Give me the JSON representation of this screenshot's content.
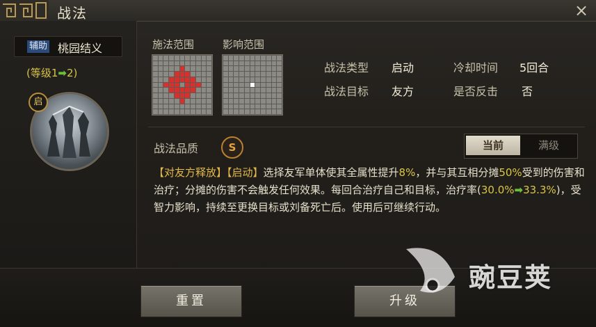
{
  "window": {
    "title": "战法",
    "close_icon": "×"
  },
  "skill": {
    "type_tag": "辅助",
    "name": "桃园结义",
    "level_prefix": "(等级1",
    "level_arrow": "➡",
    "level_suffix": "2)",
    "portrait_badge": "启"
  },
  "ranges": {
    "cast_label": "施法范围",
    "effect_label": "影响范围"
  },
  "info": {
    "type_label": "战法类型",
    "type_value": "启动",
    "cooldown_label": "冷却时间",
    "cooldown_value": "5回合",
    "target_label": "战法目标",
    "target_value": "友方",
    "counter_label": "是否反击",
    "counter_value": "否"
  },
  "quality": {
    "label": "战法品质",
    "value": "S"
  },
  "tabs": {
    "current": "当前",
    "max": "满级"
  },
  "description": {
    "p1": "【对友方释放】【启动】",
    "p2": "选择友军单体使其全属性提升",
    "p3": "8%",
    "p4": "，并与其互相分摊",
    "p5": "50%",
    "p6": "受到的伤害和治疗；分摊的伤害不会触发任何效果。每回合治疗自己和目标，治疗率(",
    "p7": "30.0%",
    "p8": "➡",
    "p9": "33.3%",
    "p10": ")，受智力影响，持续至更换目标或刘备死亡后。使用后可继续行动。"
  },
  "buttons": {
    "reset": "重置",
    "upgrade": "升级"
  },
  "watermark": {
    "text": "豌豆荚"
  }
}
